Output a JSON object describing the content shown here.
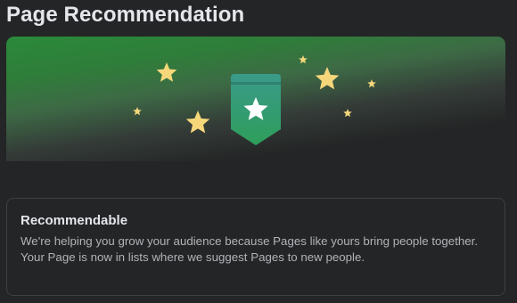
{
  "header": {
    "title": "Page Recommendation"
  },
  "banner": {
    "icon": "ribbon-star-badge-icon",
    "decoration": "sparkle-star-icons",
    "colors": {
      "gradient_top": "#2a8a3a",
      "badge_top": "#3a9a8a",
      "badge_bottom": "#2e9e5a",
      "star_gold": "#f5d77a"
    }
  },
  "card": {
    "title": "Recommendable",
    "description": "We're helping you grow your audience because Pages like yours bring people together. Your Page is now in lists where we suggest Pages to new people."
  }
}
